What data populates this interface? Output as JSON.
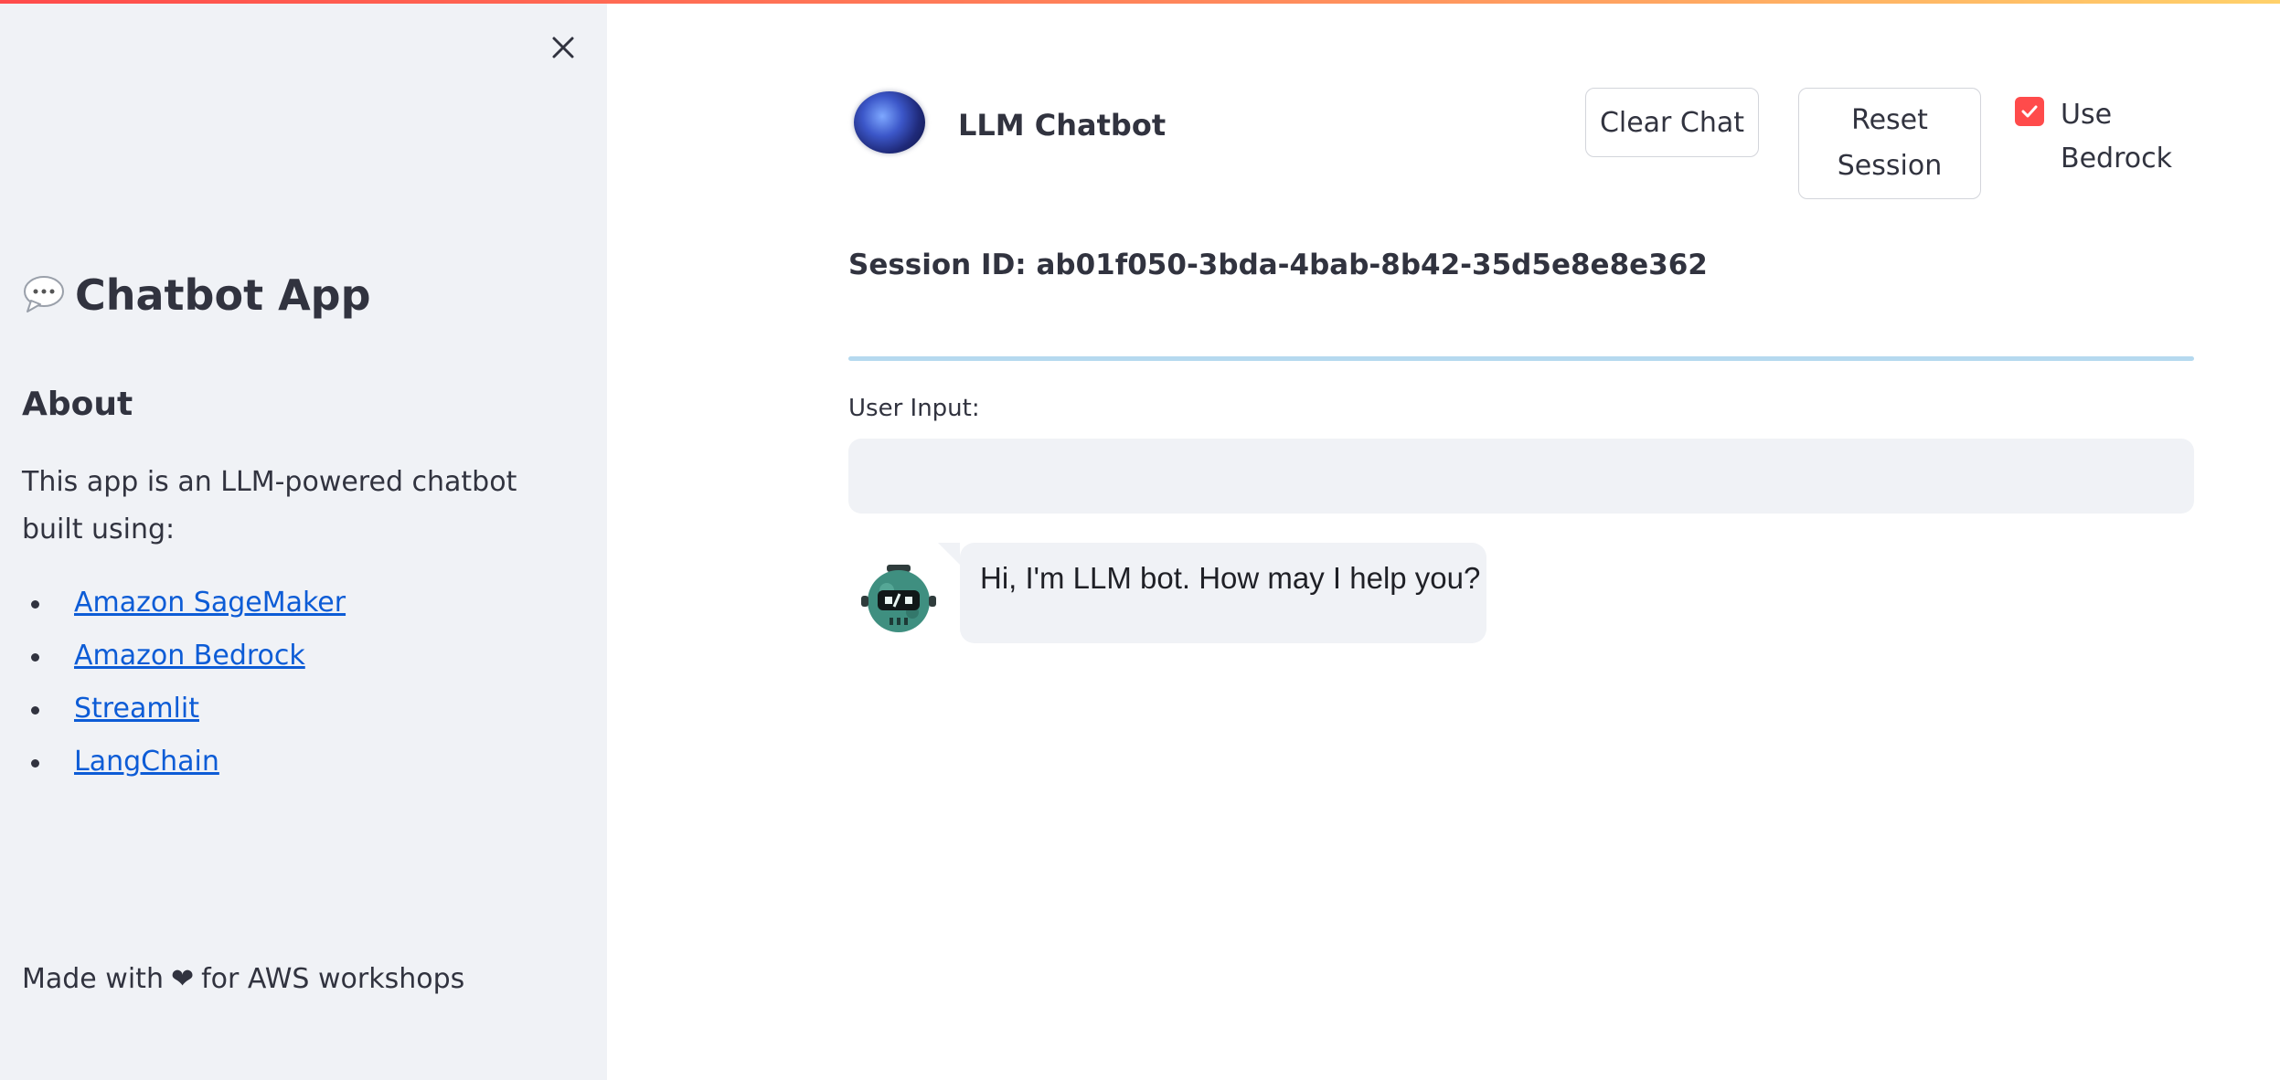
{
  "sidebar": {
    "title": "Chatbot App",
    "title_icon": "speech-balloon-icon",
    "about_heading": "About",
    "about_text": "This app is an LLM-powered chatbot built using:",
    "links": [
      {
        "label": "Amazon SageMaker"
      },
      {
        "label": "Amazon Bedrock"
      },
      {
        "label": "Streamlit"
      },
      {
        "label": "LangChain"
      }
    ],
    "footer_prefix": "Made with",
    "footer_suffix": "for AWS workshops",
    "footer_icon": "heart-icon",
    "close_icon": "close-icon"
  },
  "header": {
    "title": "LLM Chatbot",
    "logo_icon": "brain-icon",
    "clear_button": "Clear Chat",
    "reset_button": "Reset\nSession",
    "checkbox_label": "Use Bedrock",
    "checkbox_checked": true
  },
  "session": {
    "text": "Session ID: ab01f050-3bda-4bab-8b42-35d5e8e8e362"
  },
  "input": {
    "label": "User Input:",
    "value": "",
    "placeholder": ""
  },
  "messages": [
    {
      "role": "assistant",
      "avatar_icon": "robot-icon",
      "text": "Hi, I'm LLM bot. How may I help you?"
    }
  ],
  "colors": {
    "accent": "#ff4b4b",
    "sidebar_bg": "#f0f2f6",
    "link": "#0d5cd6",
    "divider": "#b5d9ef",
    "text": "#31333f"
  }
}
